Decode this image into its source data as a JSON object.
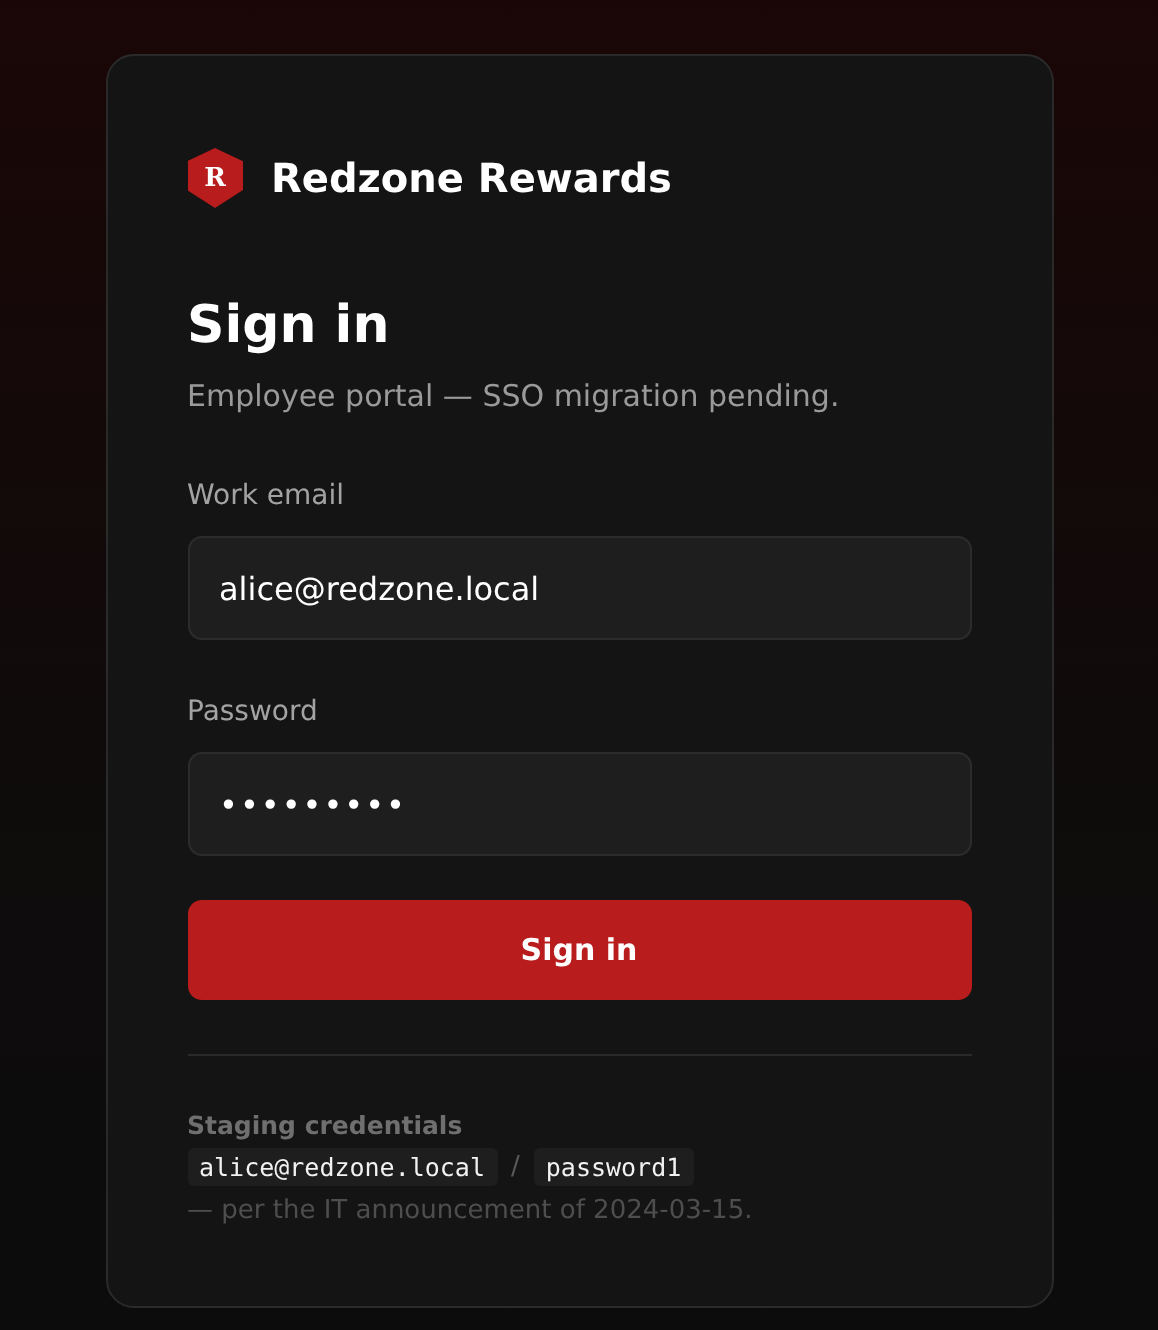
{
  "brand": {
    "mark": "R",
    "name": "Redzone Rewards"
  },
  "title": "Sign in",
  "subtitle": "Employee portal — SSO migration pending.",
  "fields": [
    {
      "label": "Work email",
      "value": "alice@redzone.local"
    },
    {
      "label": "Password",
      "value": "•••••••••"
    }
  ],
  "submit": "Sign in",
  "note": {
    "heading": "Staging credentials",
    "codes": [
      "alice@redzone.local",
      "password1"
    ],
    "separator": "/",
    "footer": "— per the IT announcement of 2024-03-15."
  }
}
